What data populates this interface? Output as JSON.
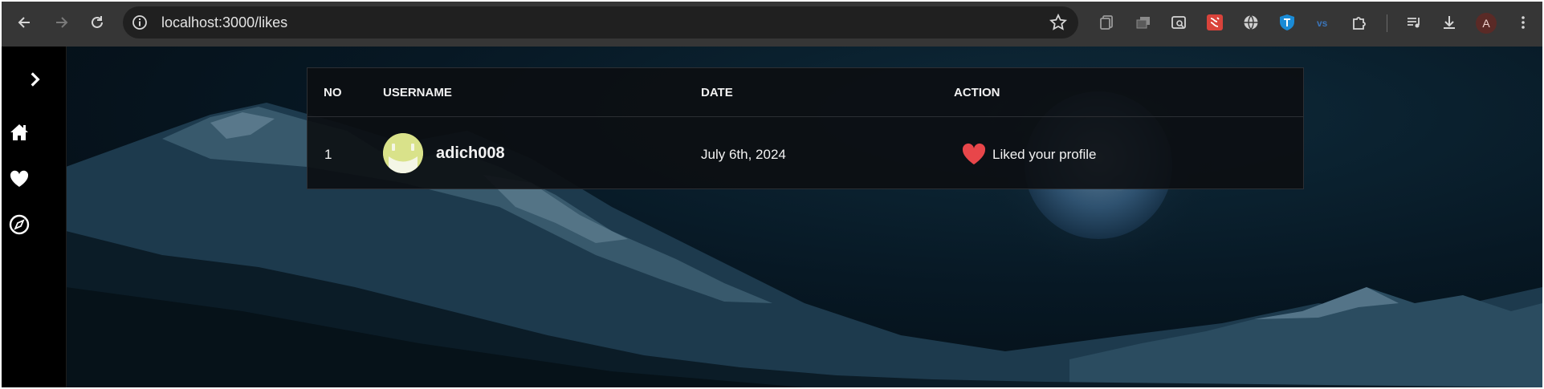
{
  "browser": {
    "url": "localhost:3000/likes",
    "profile_initial": "A"
  },
  "table": {
    "headers": [
      "NO",
      "USERNAME",
      "DATE",
      "ACTION"
    ],
    "rows": [
      {
        "no": "1",
        "username": "adich008",
        "date": "July 6th, 2024",
        "action": "Liked your profile"
      }
    ]
  },
  "colors": {
    "heart": "#e8464a",
    "avatar_bg": "#d9e28a"
  }
}
